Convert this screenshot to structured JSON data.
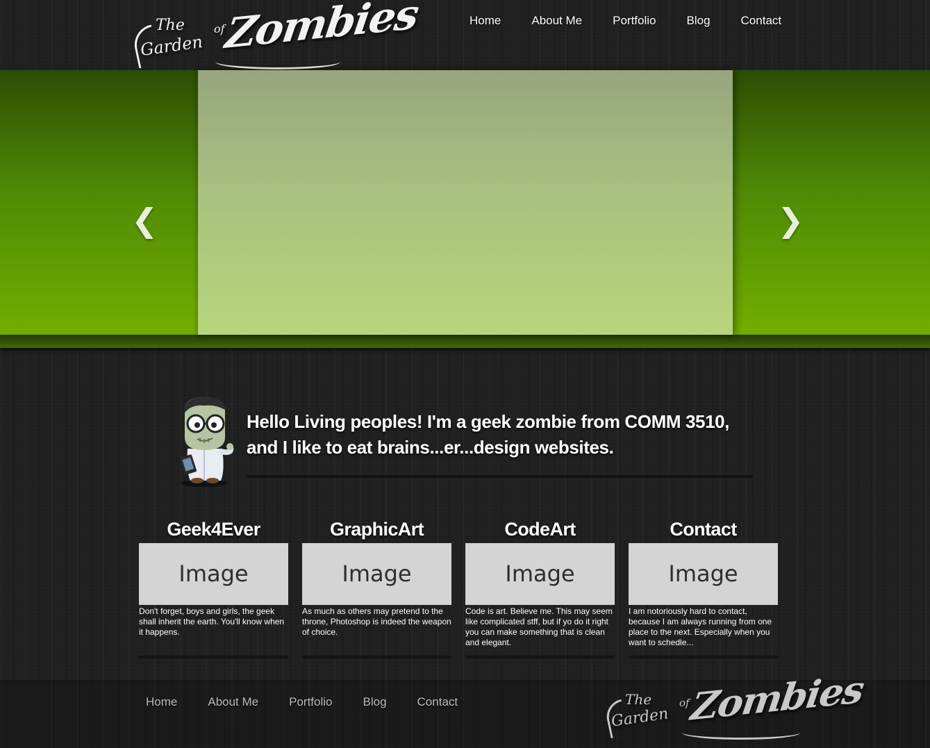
{
  "brand": {
    "logo_the": "The",
    "logo_garden": "Garden",
    "logo_of": "of",
    "logo_zombies": "Zombies"
  },
  "nav": {
    "items": [
      "Home",
      "About Me",
      "Portfolio",
      "Blog",
      "Contact"
    ]
  },
  "slider": {
    "prev_label": "❮",
    "next_label": "❯"
  },
  "intro": {
    "text": "Hello Living peoples! I'm a geek zombie from COMM 3510, and I like to eat brains...er...design websites."
  },
  "features": [
    {
      "title": "Geek4Ever",
      "image_label": "Image",
      "description": "Don't forget, boys and girls, the geek shall inherit the earth. You'll know when it happens."
    },
    {
      "title": "GraphicArt",
      "image_label": "Image",
      "description": "As much as others may pretend to the throne, Photoshop is indeed the weapon of choice."
    },
    {
      "title": "CodeArt",
      "image_label": "Image",
      "description": "Code is art. Believe me. This may seem like complicated stff, but if yo do it right you can make something that is clean and elegant."
    },
    {
      "title": "Contact",
      "image_label": "Image",
      "description": "I am notoriously hard to contact, because I am always running from one place to the next. Especially when you want to schedle..."
    }
  ],
  "footer": {
    "nav_items": [
      "Home",
      "About Me",
      "Portfolio",
      "Blog",
      "Contact"
    ]
  },
  "colors": {
    "accent_green": "#72ae00",
    "dark_green": "#2c4d04",
    "slide_panel": "#b6d67b",
    "background": "#202020",
    "image_placeholder": "#d4d4d4"
  },
  "icons": {
    "slider_prev": "chevron-left-icon",
    "slider_next": "chevron-right-icon",
    "avatar": "zombie-avatar-icon"
  }
}
